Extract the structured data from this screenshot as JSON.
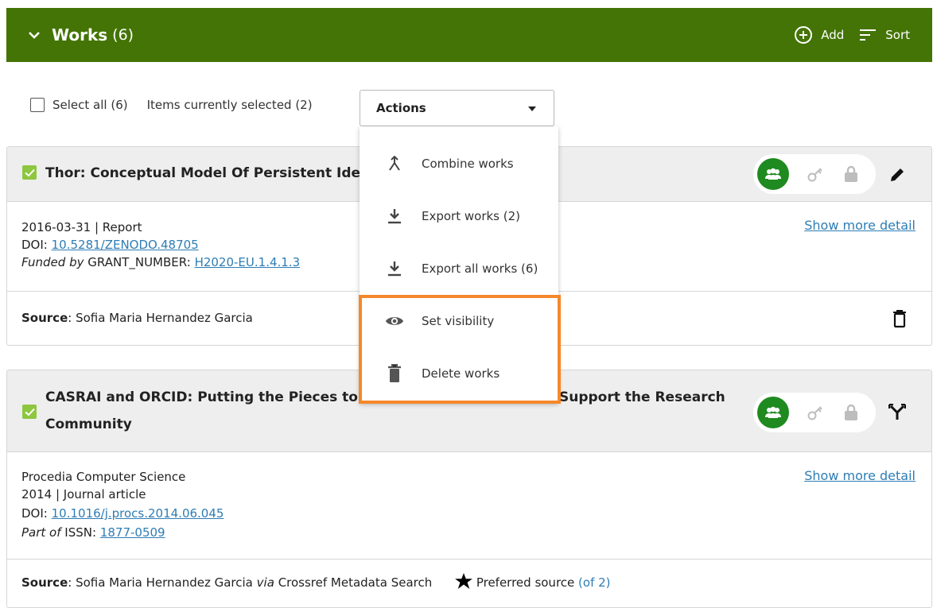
{
  "header": {
    "title": "Works",
    "count": "(6)",
    "add_label": "Add",
    "sort_label": "Sort",
    "bg_color": "#447405"
  },
  "toolbar": {
    "select_all": "Select all (6)",
    "selected": "Items currently selected (2)",
    "actions_label": "Actions"
  },
  "dropdown": {
    "items": [
      {
        "label": "Combine works",
        "icon": "combine-icon"
      },
      {
        "label": "Export works (2)",
        "icon": "download-icon"
      },
      {
        "label": "Export all works (6)",
        "icon": "download-icon"
      },
      {
        "label": "Set visibility",
        "icon": "eye-icon"
      },
      {
        "label": "Delete works",
        "icon": "trash-icon"
      }
    ],
    "highlight_color": "#f5882a"
  },
  "works": [
    {
      "title": "Thor: Conceptual Model Of Persistent Ide",
      "line1": "2016-03-31 | Report",
      "doi_label": "DOI:",
      "doi": "10.5281/ZENODO.48705",
      "funded_prefix": "Funded by",
      "funded_text": "GRANT_NUMBER:",
      "funded_link": "H2020-EU.1.4.1.3",
      "show_more": "Show more detail",
      "source_label": "Source",
      "source_text": ": Sofia Maria Hernandez Garcia"
    },
    {
      "title_left": "CASRAI and ORCID: Putting the Pieces to",
      "title_right": "Support the Research",
      "title_line2": "Community",
      "line1": "Procedia Computer Science",
      "line2": "2014 | Journal article",
      "doi_label": "DOI:",
      "doi": "10.1016/j.procs.2014.06.045",
      "part_prefix": "Part of",
      "part_text": "ISSN:",
      "part_link": "1877-0509",
      "show_more": "Show more detail",
      "source_label": "Source",
      "source_text": ": Sofia Maria Hernandez Garcia",
      "via": "via",
      "via_text": "Crossref Metadata Search",
      "preferred": "Preferred source",
      "preferred_count": "(of 2)"
    }
  ]
}
